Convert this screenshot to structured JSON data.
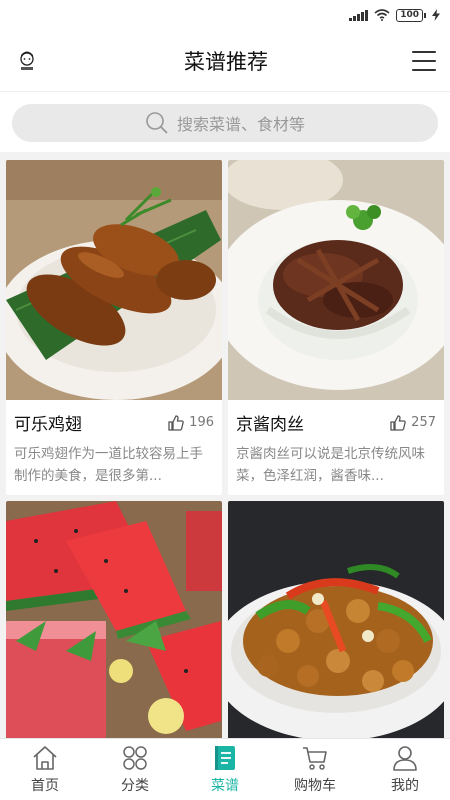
{
  "status": {
    "battery": "100"
  },
  "header": {
    "title": "菜谱推荐"
  },
  "search": {
    "placeholder": "搜索菜谱、食材等"
  },
  "recipes": [
    {
      "title": "可乐鸡翅",
      "likes": "196",
      "desc": "可乐鸡翅作为一道比较容易上手制作的美食，是很多第..."
    },
    {
      "title": "京酱肉丝",
      "likes": "257",
      "desc": "京酱肉丝可以说是北京传统风味菜，色泽红润，酱香味..."
    },
    {
      "title": "",
      "likes": "",
      "desc": ""
    },
    {
      "title": "",
      "likes": "",
      "desc": ""
    }
  ],
  "nav": [
    {
      "label": "首页",
      "icon": "home-icon"
    },
    {
      "label": "分类",
      "icon": "category-icon"
    },
    {
      "label": "菜谱",
      "icon": "recipe-book-icon",
      "active": true
    },
    {
      "label": "购物车",
      "icon": "cart-icon"
    },
    {
      "label": "我的",
      "icon": "user-icon"
    }
  ],
  "colors": {
    "accent": "#1bb5a6"
  }
}
